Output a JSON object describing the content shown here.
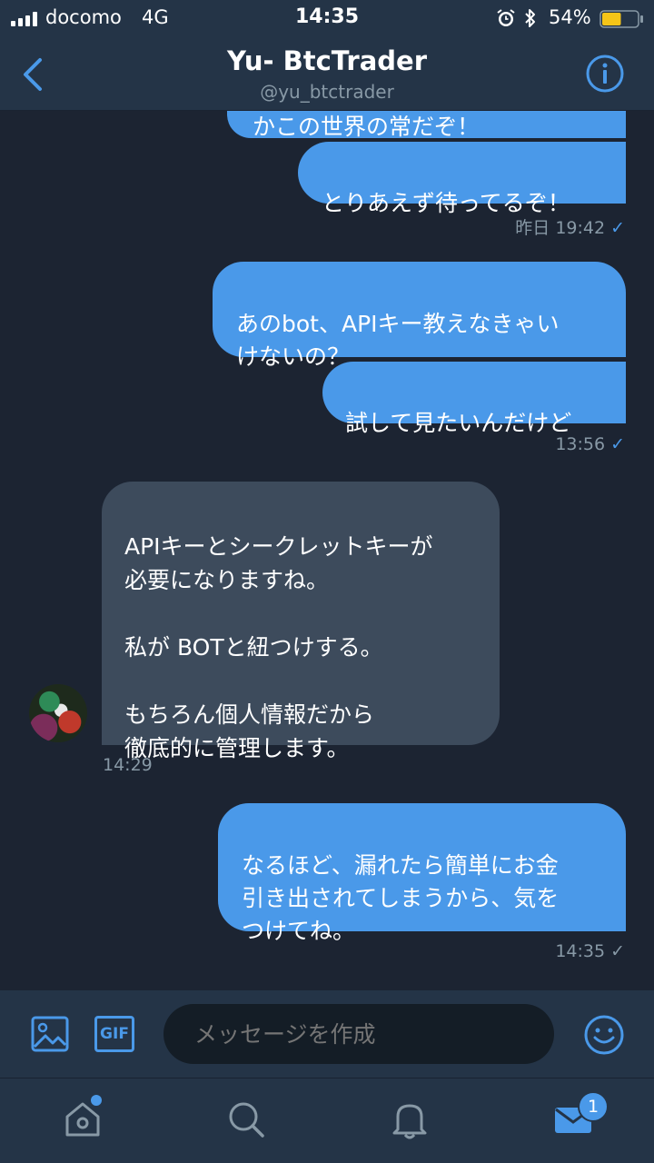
{
  "status_bar": {
    "carrier": "docomo",
    "network": "4G",
    "time": "14:35",
    "battery": "54%",
    "battery_level": 0.54,
    "icons": [
      "signal-icon",
      "alarm-icon",
      "bluetooth-icon",
      "battery-icon"
    ]
  },
  "header": {
    "title": "Yu- BtcTrader",
    "handle": "@yu_btctrader",
    "back_icon": "chevron-left-icon",
    "info_icon": "info-icon"
  },
  "messages": [
    {
      "side": "sent",
      "text": "かこの世界の常だぞ！"
    },
    {
      "side": "sent",
      "text": "とりあえず待ってるぞ！"
    },
    {
      "timestamp": "昨日 19:42",
      "read": true
    },
    {
      "side": "sent",
      "text": "あのbot、APIキー教えなきゃい\nけないの？"
    },
    {
      "side": "sent",
      "text": "試して見たいんだけど"
    },
    {
      "timestamp": "13:56",
      "read": true
    },
    {
      "side": "received",
      "text": "APIキーとシークレットキーが\n必要になりますね。\n\n私が BOTと紐つけする。\n\nもちろん個人情報だから\n徹底的に管理します。"
    },
    {
      "timestamp": "14:29"
    },
    {
      "side": "sent",
      "text": "なるほど、漏れたら簡単にお金\n引き出されてしまうから、気を\nつけてね。"
    },
    {
      "timestamp": "14:35",
      "read": false
    }
  ],
  "composer": {
    "placeholder": "メッセージを作成",
    "gif_label": "GIF",
    "media_icon": "image-icon",
    "emoji_icon": "smiley-icon"
  },
  "tabbar": {
    "items": [
      "home-icon",
      "search-icon",
      "bell-icon",
      "mail-icon"
    ],
    "mail_badge": "1"
  },
  "colors": {
    "background": "#1c2432",
    "bar": "#243447",
    "accent": "#4a99e9",
    "received_bubble": "#3d4b5c",
    "muted_text": "#8899a6"
  }
}
